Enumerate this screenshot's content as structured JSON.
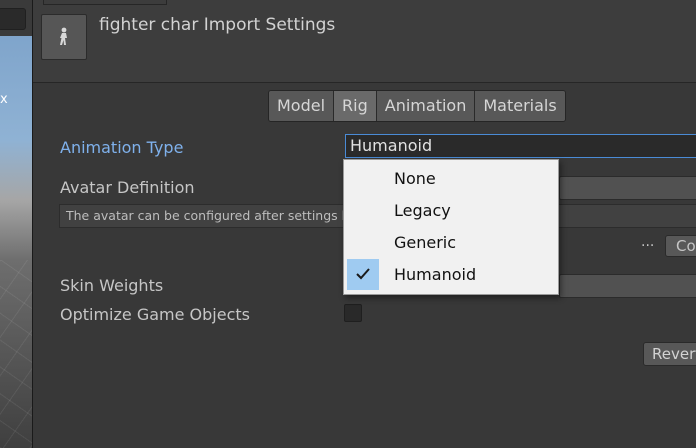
{
  "window": {
    "title": "fighter char Import Settings"
  },
  "scene": {
    "label": "x"
  },
  "tabs": [
    {
      "label": "Model",
      "active": false
    },
    {
      "label": "Rig",
      "active": true
    },
    {
      "label": "Animation",
      "active": false
    },
    {
      "label": "Materials",
      "active": false
    }
  ],
  "rig": {
    "animation_type_label": "Animation Type",
    "animation_type_value": "Humanoid",
    "avatar_definition_label": "Avatar Definition",
    "info_text": "The avatar can be configured after settings have been applied.",
    "ellipsis": "...",
    "configure_button": "Configure...",
    "skin_weights_label": "Skin Weights",
    "optimize_label": "Optimize Game Objects",
    "optimize_checked": false,
    "revert_button": "Revert"
  },
  "dropdown": {
    "options": [
      {
        "label": "None",
        "selected": false
      },
      {
        "label": "Legacy",
        "selected": false
      },
      {
        "label": "Generic",
        "selected": false
      },
      {
        "label": "Humanoid",
        "selected": true
      }
    ],
    "selection_color": "#9fcbf1"
  },
  "colors": {
    "background": "#383838",
    "highlight_label": "#7fb1ec",
    "dropdown_bg": "#f1f1f1"
  }
}
